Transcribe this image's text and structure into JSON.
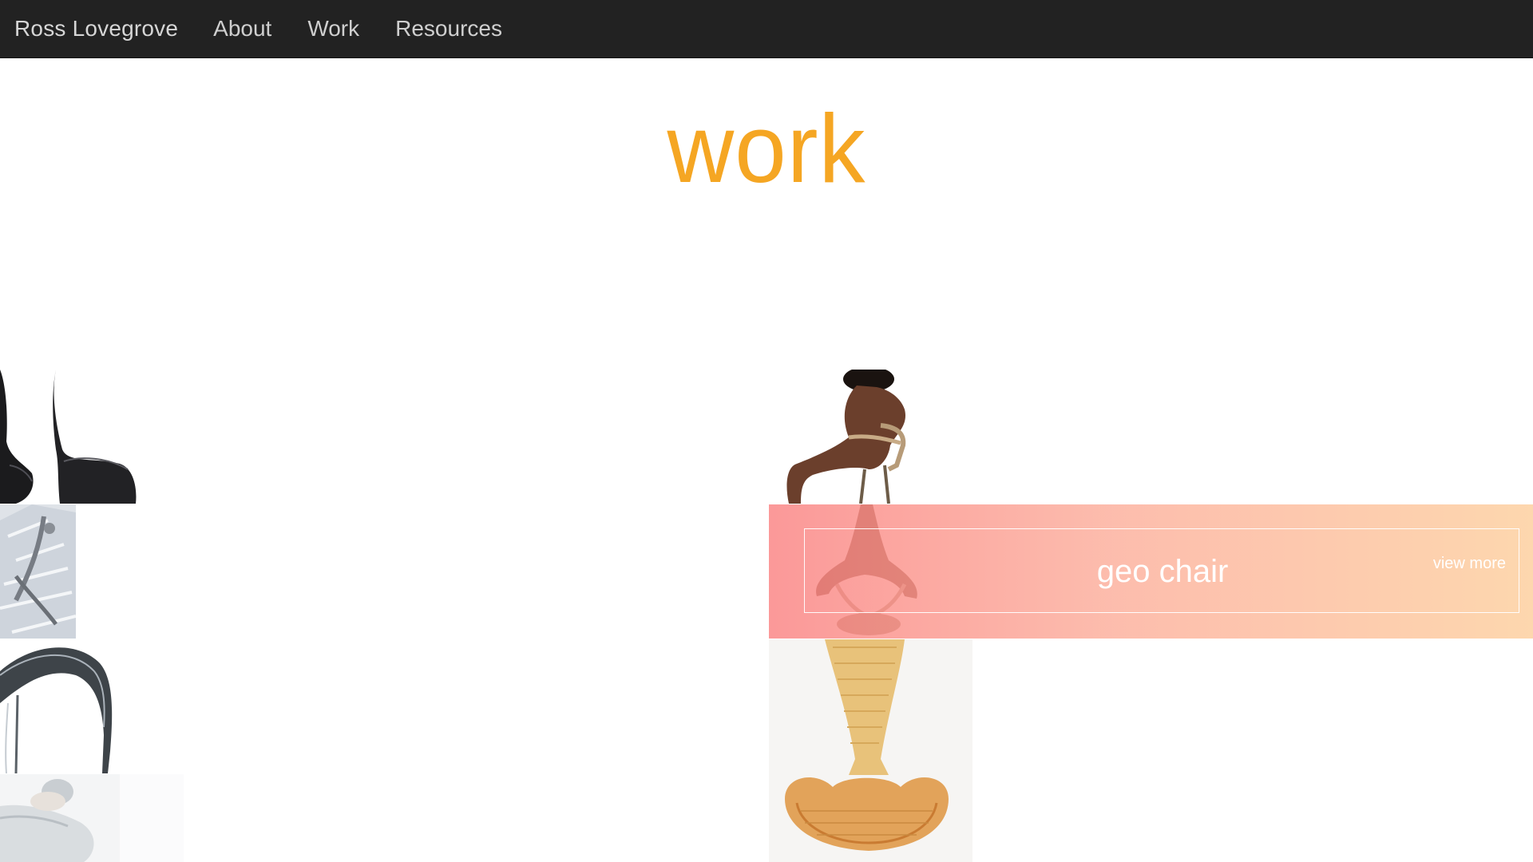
{
  "nav": {
    "brand": "Ross Lovegrove",
    "links": [
      "About",
      "Work",
      "Resources"
    ]
  },
  "page": {
    "title": "work"
  },
  "featured": {
    "title": "geo chair",
    "link_label": "view more"
  },
  "colors": {
    "navbar_bg": "#222222",
    "nav_text": "#cfcfcf",
    "title_accent": "#f5a623",
    "overlay_start": "#fa8282",
    "overlay_end": "#fdd0a0"
  },
  "thumbnails": [
    {
      "name": "dark-sculptural-chairs"
    },
    {
      "name": "translucent-chair-frame"
    },
    {
      "name": "white-curved-chair-arm"
    },
    {
      "name": "reclining-woman-pod"
    },
    {
      "name": "woman-seated-on-chair"
    },
    {
      "name": "geo-chair-back"
    },
    {
      "name": "wicker-tall-chair"
    }
  ]
}
